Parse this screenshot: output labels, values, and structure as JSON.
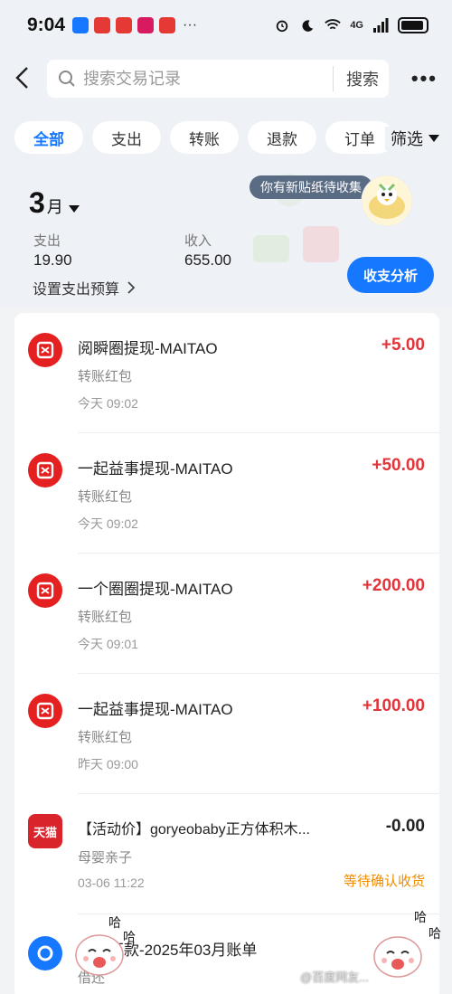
{
  "status_bar": {
    "time": "9:04",
    "dots": "···",
    "network": "4G"
  },
  "header": {
    "search_placeholder": "搜索交易记录",
    "search_button": "搜索",
    "more": "•••"
  },
  "tabs": [
    {
      "label": "全部",
      "active": true
    },
    {
      "label": "支出",
      "active": false
    },
    {
      "label": "转账",
      "active": false
    },
    {
      "label": "退款",
      "active": false
    },
    {
      "label": "订单",
      "active": false
    }
  ],
  "filter_label": "筛选",
  "summary": {
    "month": "3",
    "month_unit": "月",
    "expense_label": "支出",
    "expense_value": "19.90",
    "income_label": "收入",
    "income_value": "655.00",
    "budget_label": "设置支出预算",
    "sticker_text": "你有新贴纸待收集",
    "analysis_button": "收支分析"
  },
  "transactions": [
    {
      "title": "阅瞬圈提现-MAITAO",
      "sub": "转账红包",
      "time": "今天 09:02",
      "amount": "+5.00"
    },
    {
      "title": "一起益事提现-MAITAO",
      "sub": "转账红包",
      "time": "今天 09:02",
      "amount": "+50.00"
    },
    {
      "title": "一个圈圈提现-MAITAO",
      "sub": "转账红包",
      "time": "今天 09:01",
      "amount": "+200.00"
    },
    {
      "title": "一起益事提现-MAITAO",
      "sub": "转账红包",
      "time": "昨天 09:00",
      "amount": "+100.00"
    },
    {
      "title": "【活动价】goryeobaby正方体积木...",
      "sub": "母婴亲子",
      "time": "03-06 11:22",
      "amount": "-0.00",
      "status": "等待确认收货",
      "icon_text": "天猫"
    },
    {
      "title": "主动还款-2025年03月账单",
      "sub": "借还"
    }
  ],
  "mascot_text": "哈",
  "watermark": "@百度网友..."
}
